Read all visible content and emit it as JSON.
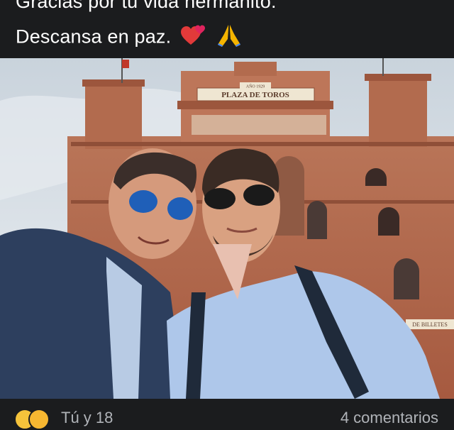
{
  "post": {
    "line1": "Gracias por tu vida hermanito.",
    "line2": "Descansa en paz."
  },
  "photo": {
    "plaque_year": "AÑO 1929",
    "plaque_name": "PLAZA DE TOROS",
    "ticket_sign": "DE BILLETES"
  },
  "footer": {
    "reactions_text": "Tú y 18",
    "comments_text": "4 comentarios"
  },
  "colors": {
    "background": "#1b1c1e",
    "building": "#b86a4e",
    "sky": "#d7dee5",
    "heart": "#e0245e"
  },
  "icons": [
    "heart-icon",
    "praying-hands-icon",
    "reaction-haha-icon",
    "reaction-wow-icon"
  ]
}
